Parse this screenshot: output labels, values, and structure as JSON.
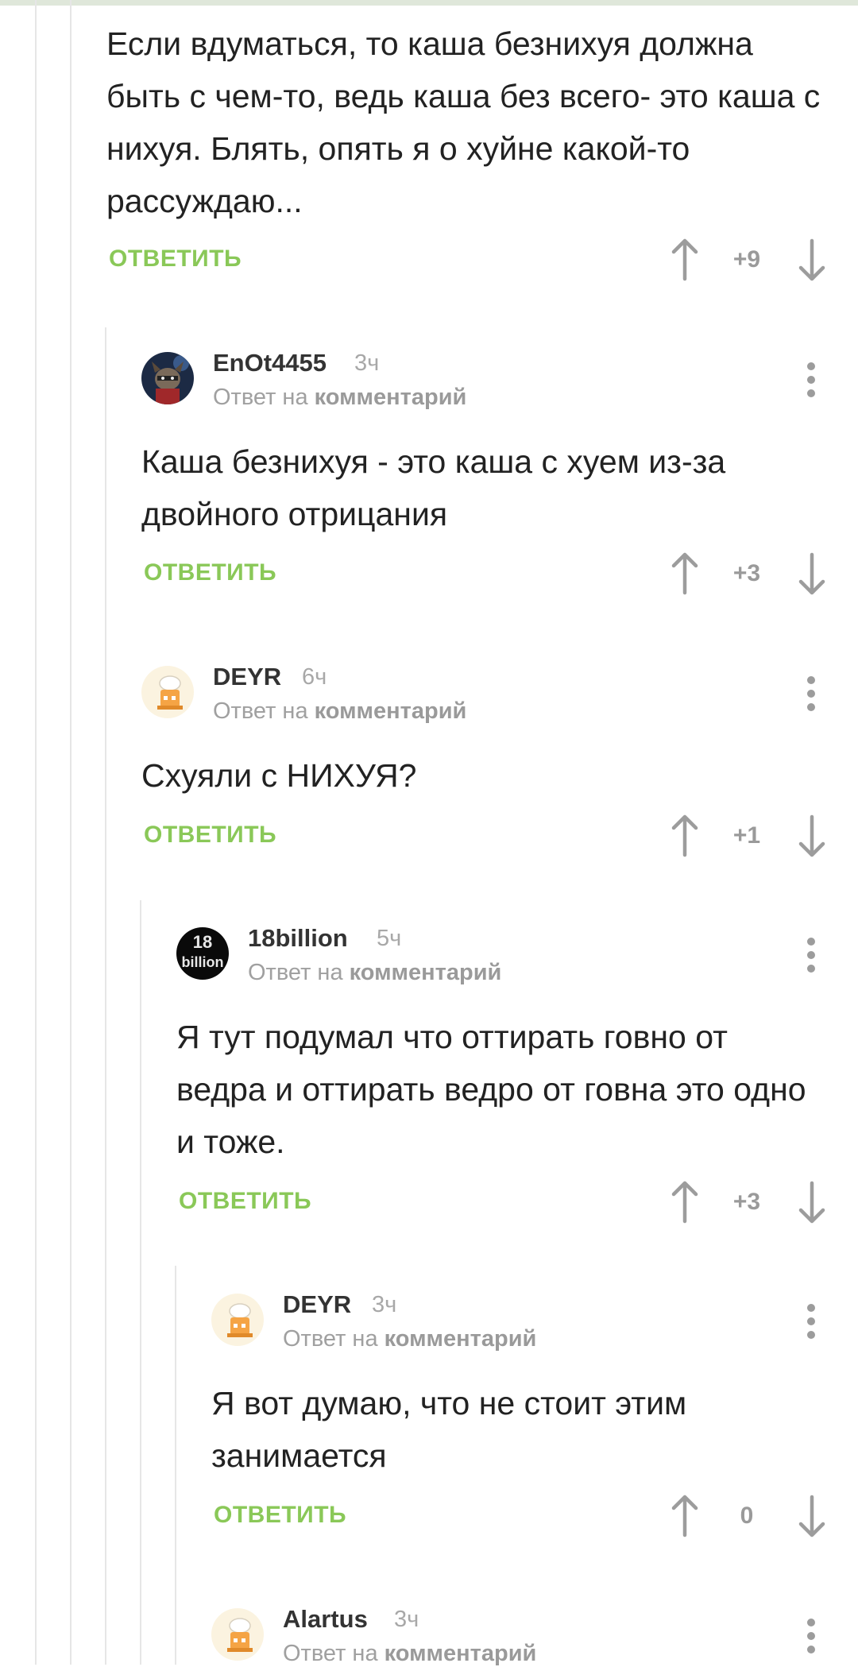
{
  "ui": {
    "reply_label": "ОТВЕТИТЬ",
    "reply_to_prefix": "Ответ на",
    "reply_to_link": "комментарий"
  },
  "comments": [
    {
      "id": "c0",
      "body": "Если вдуматься, то каша безнихуя должна быть с чем-то, ведь каша без всего- это каша с нихуя. Блять, опять я о хуйне какой-то рассуждаю...",
      "score": "+9"
    },
    {
      "id": "c1",
      "author": "EnOt4455",
      "time": "3ч",
      "avatar_icon": "raccoon-avatar",
      "body": "Каша безнихуя - это каша с хуем из-за двойного отрицания",
      "score": "+3"
    },
    {
      "id": "c2",
      "author": "DEYR",
      "time": "6ч",
      "avatar_icon": "chef-avatar",
      "body": "Схуяли с НИХУЯ?",
      "score": "+1"
    },
    {
      "id": "c3",
      "author": "18billion",
      "time": "5ч",
      "avatar_icon": "18billion-avatar",
      "avatar_text": "18 billion",
      "body": "Я тут подумал что оттирать говно от ведра и оттирать ведро от говна это одно и тоже.",
      "score": "+3"
    },
    {
      "id": "c4",
      "author": "DEYR",
      "time": "3ч",
      "avatar_icon": "chef-avatar",
      "body": "Я вот думаю, что не стоит этим занимается",
      "score": "0"
    },
    {
      "id": "c5",
      "author": "Alartus",
      "time": "3ч",
      "avatar_icon": "chef-avatar"
    }
  ],
  "colors": {
    "accent_green": "#8ac858",
    "thread_line": "#e6e6e6",
    "muted_text": "#a0a0a0"
  }
}
